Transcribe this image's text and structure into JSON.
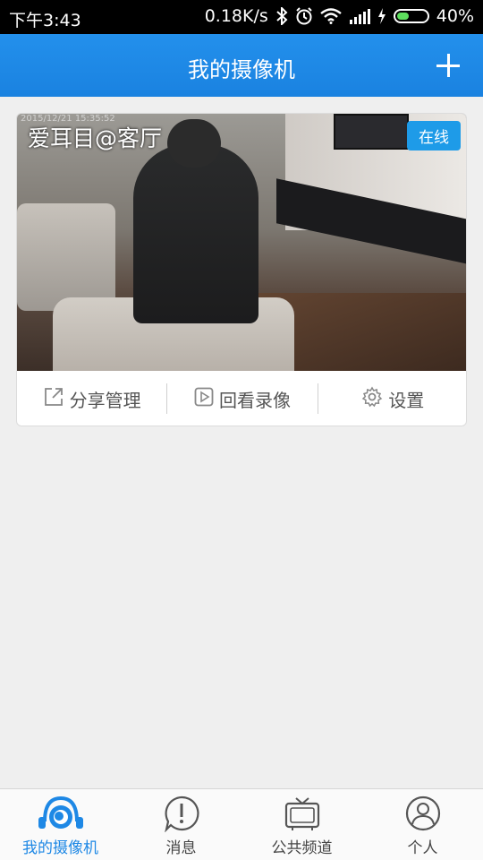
{
  "status_bar": {
    "time": "下午3:43",
    "net_speed": "0.18K/s",
    "battery": "40%",
    "battery_level": 0.4
  },
  "header": {
    "title": "我的摄像机",
    "add_icon": "plus-icon"
  },
  "camera": {
    "name": "爱耳目@客厅",
    "status": "在线",
    "timestamp": "2015/12/21 15:35:52",
    "actions": [
      {
        "label": "分享管理",
        "icon": "share-icon"
      },
      {
        "label": "回看录像",
        "icon": "play-icon"
      },
      {
        "label": "设置",
        "icon": "gear-icon"
      }
    ]
  },
  "tabs": [
    {
      "label": "我的摄像机",
      "icon": "camera-eye-icon",
      "active": true
    },
    {
      "label": "消息",
      "icon": "message-icon",
      "active": false
    },
    {
      "label": "公共频道",
      "icon": "tv-icon",
      "active": false
    },
    {
      "label": "个人",
      "icon": "user-icon",
      "active": false
    }
  ],
  "colors": {
    "accent": "#1e88e5",
    "online_badge": "#1e9be8",
    "battery_fill": "#5ee05e"
  }
}
